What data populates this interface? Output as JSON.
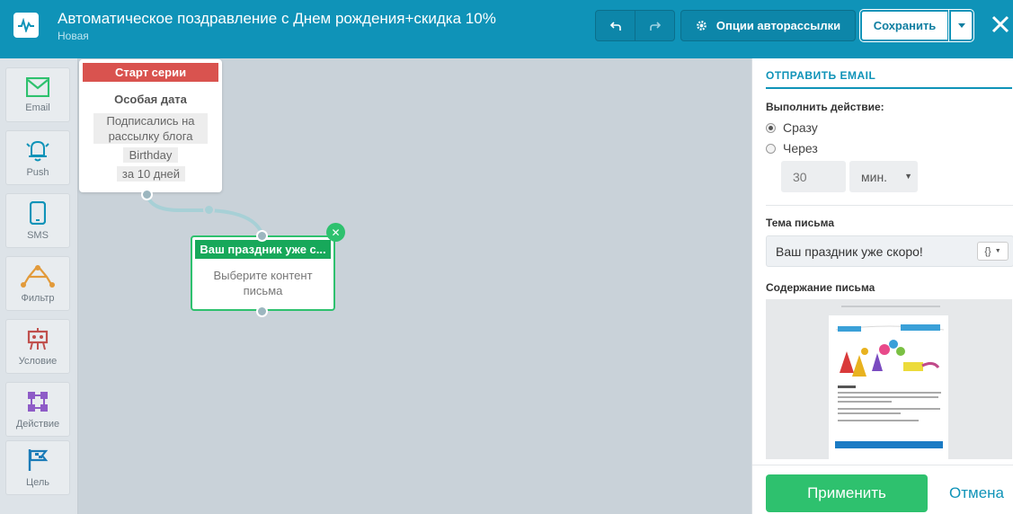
{
  "header": {
    "title": "Автоматическое поздравление с Днем рождения+скидка 10%",
    "status": "Новая",
    "options_label": "Опции авторассылки",
    "save_label": "Сохранить"
  },
  "sidebar": {
    "items": [
      {
        "label": "Email",
        "icon": "envelope-icon"
      },
      {
        "label": "Push",
        "icon": "bell-icon"
      },
      {
        "label": "SMS",
        "icon": "phone-icon"
      },
      {
        "label": "Фильтр",
        "icon": "filter-icon"
      },
      {
        "label": "Условие",
        "icon": "condition-icon"
      },
      {
        "label": "Действие",
        "icon": "action-icon"
      },
      {
        "label": "Цель",
        "icon": "flag-icon"
      }
    ]
  },
  "canvas": {
    "start_card": {
      "head": "Старт серии",
      "subtitle": "Особая дата",
      "tag1": "Подписались на рассылку блога",
      "tag2": "Birthday",
      "tag3": "за 10 дней"
    },
    "email_card": {
      "head": "Ваш праздник уже с...",
      "body": "Выберите контент письма"
    }
  },
  "panel": {
    "title": "ОТПРАВИТЬ EMAIL",
    "action_label": "Выполнить действие:",
    "option_now": "Сразу",
    "option_later": "Через",
    "delay_value": "30",
    "delay_unit": "мин.",
    "subject_label": "Тема письма",
    "subject_value": "Ваш праздник уже скоро!",
    "content_label": "Содержание письма",
    "apply_label": "Применить",
    "cancel_label": "Отмена"
  },
  "colors": {
    "header": "#0f93b8",
    "start": "#d9534f",
    "email": "#17a85a",
    "apply": "#2ec16e"
  }
}
